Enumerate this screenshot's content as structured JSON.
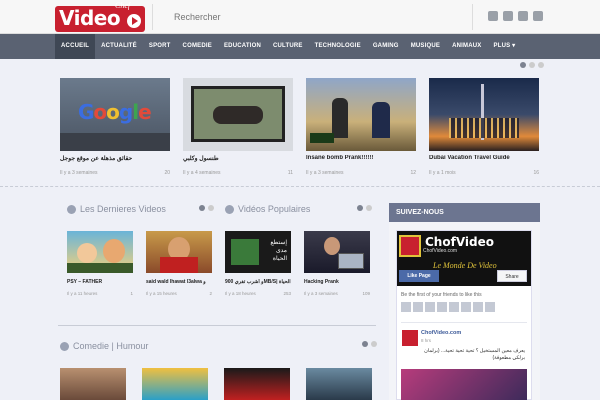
{
  "header": {
    "logo": "Video",
    "logo_chef": "Chef",
    "search_placeholder": "Rechercher",
    "social_icons": [
      "facebook-icon",
      "twitter-icon",
      "youtube-icon",
      "email-icon"
    ]
  },
  "nav": {
    "items": [
      "ACCUEIL",
      "ACTUALITÉ",
      "SPORT",
      "COMEDIE",
      "EDUCATION",
      "CULTURE",
      "TECHNOLOGIE",
      "GAMING",
      "MUSIQUE",
      "ANIMAUX",
      "PLUS ▾"
    ],
    "active": "ACCUEIL"
  },
  "slider": [
    {
      "title": "حقائق مذهلة عن موقع جوجل",
      "time": "Il y a 3 semaines",
      "views": "20"
    },
    {
      "title": "طنسول وكلبي",
      "time": "Il y a 4 semaines",
      "views": "11"
    },
    {
      "title": "Insane bomb Prank!!!!!!",
      "time": "Il y a 3 semaines",
      "views": "12"
    },
    {
      "title": "Dubai Vacation Travel Guide",
      "time": "Il y a 1 mois",
      "views": "16"
    }
  ],
  "sections": {
    "latest_title": "Les Dernieres Videos",
    "popular_title": "Vidéos Populaires",
    "comedy_title": "Comedie | Humour"
  },
  "latest": [
    {
      "title": "PSY – FATHER",
      "time": "Il y a 11 heures",
      "views": "1"
    },
    {
      "title": "said wald lhawat l3alwa و",
      "time": "Il y a 15 heures",
      "views": "2"
    }
  ],
  "popular": [
    {
      "title": "و أشرب تفري 900MB/S| الحياة",
      "time": "Il y a 18 heures",
      "views": "253"
    },
    {
      "title": "Hacking Prank",
      "time": "Il y a 3 semaines",
      "views": "109"
    }
  ],
  "sidebar": {
    "title": "SUIVEZ-NOUS",
    "fb": {
      "banner_name": "ChofVideo",
      "banner_site": "ChofVideo.com",
      "banner_tag": "Le Monde De Video",
      "banner_small": "Chof Video",
      "like": "Like Page",
      "share": "Share",
      "friends": "Be the first of your friends to like this",
      "post_name": "ChofVideo.com",
      "post_time": "8 hrs",
      "post_text": "يعرف معين المستخيل ؟ تحية تحية تحية... (برلمان برلكي مطعوفة)"
    }
  },
  "colors": {
    "brand": "#c8202f",
    "nav_bg": "#5a6272",
    "nav_active": "#3f4755",
    "sidebar_head": "#6c7590"
  }
}
